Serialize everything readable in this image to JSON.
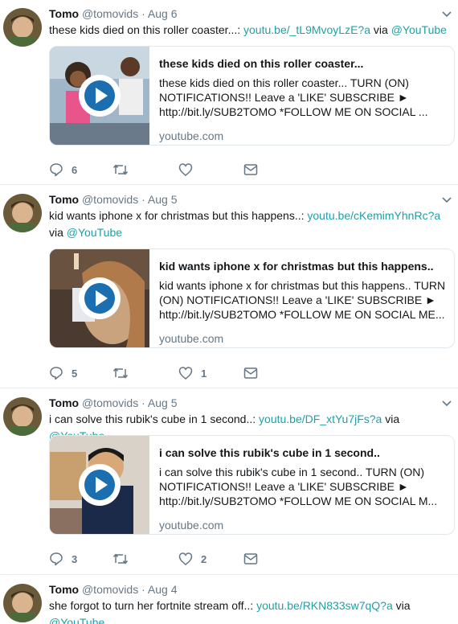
{
  "colors": {
    "link": "#1da1a6",
    "muted": "#657786",
    "icon": "#657786"
  },
  "tweets": [
    {
      "name": "Tomo",
      "handle": "@tomovids",
      "sep": "·",
      "date": "Aug 6",
      "text_prefix": "these kids died on this roller coaster...: ",
      "url": "youtu.be/_tL9MvoyLzE?a",
      "via": " via ",
      "via_handle": "@YouTube",
      "card": {
        "title": "these kids died on this roller coaster...",
        "desc": "these kids died on this roller coaster... TURN (ON) NOTIFICATIONS!! Leave a 'LIKE' SUBSCRIBE ► http://bit.ly/SUB2TOMO *FOLLOW ME ON SOCIAL ...",
        "domain": "youtube.com"
      },
      "replies": "6",
      "retweets": "",
      "likes": ""
    },
    {
      "name": "Tomo",
      "handle": "@tomovids",
      "sep": "·",
      "date": "Aug 5",
      "text_prefix": "kid wants iphone x for christmas but this happens..: ",
      "url": "youtu.be/cKemimYhnRc?a",
      "via": " via ",
      "via_handle": "@YouTube",
      "card": {
        "title": "kid wants iphone x for christmas but this happens..",
        "desc": "kid wants iphone x for christmas but this happens.. TURN (ON) NOTIFICATIONS!! Leave a 'LIKE' SUBSCRIBE ► http://bit.ly/SUB2TOMO *FOLLOW ME ON SOCIAL ME...",
        "domain": "youtube.com"
      },
      "replies": "5",
      "retweets": "",
      "likes": "1"
    },
    {
      "name": "Tomo",
      "handle": "@tomovids",
      "sep": "·",
      "date": "Aug 5",
      "text_prefix": "i can solve this rubik's cube in 1 second..: ",
      "url": "youtu.be/DF_xtYu7jFs?a",
      "via": " via ",
      "via_handle": "@YouTube",
      "card": {
        "title": "i can solve this rubik's cube in 1 second..",
        "desc": "i can solve this rubik's cube in 1 second.. TURN (ON) NOTIFICATIONS!! Leave a 'LIKE' SUBSCRIBE ► http://bit.ly/SUB2TOMO *FOLLOW ME ON SOCIAL M...",
        "domain": "youtube.com"
      },
      "replies": "3",
      "retweets": "",
      "likes": "2"
    },
    {
      "name": "Tomo",
      "handle": "@tomovids",
      "sep": "·",
      "date": "Aug 4",
      "text_prefix": "she forgot to turn her fortnite stream off..: ",
      "url": "youtu.be/RKN833sw7qQ?a",
      "via": " via",
      "via_handle": "@YouTube"
    }
  ]
}
